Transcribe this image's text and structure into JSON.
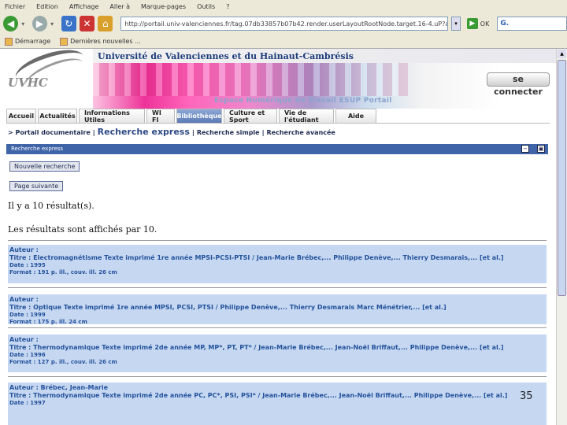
{
  "browser": {
    "menu": [
      "Fichier",
      "Edition",
      "Affichage",
      "Aller à",
      "Marque-pages",
      "Outils",
      "?"
    ],
    "address": "http://portail.univ-valenciennes.fr/tag.07db33857b07b42.render.userLayoutRootNode.target.16-4.uP?actio",
    "go_label": "OK",
    "search_value": "G.",
    "bookmarks": [
      "Démarrage",
      "Dernières nouvelles ..."
    ]
  },
  "header": {
    "university": "Université de Valenciennes et du Hainaut-Cambrésis",
    "logo_text": "UVHC",
    "espace": "Espace Numérique de Travail ESUP Portail",
    "connect_label": "se connecter"
  },
  "tabs": [
    {
      "label": "Accueil",
      "active": false
    },
    {
      "label": "Actualités",
      "active": false
    },
    {
      "label": "Informations Utiles",
      "active": false
    },
    {
      "label": "WI FI",
      "active": false
    },
    {
      "label": "Bibliothèque",
      "active": true
    },
    {
      "label": "Culture et Sport",
      "active": false
    },
    {
      "label": "Vie de l'étudiant",
      "active": false
    },
    {
      "label": "Aide",
      "active": false
    }
  ],
  "breadcrumb": {
    "arrow": ">",
    "items": [
      "Portail documentaire",
      "Recherche express",
      "Recherche simple",
      "Recherche avancée"
    ]
  },
  "portlet": {
    "title": "Recherche express",
    "min_icon": "−",
    "max_icon": "▣"
  },
  "buttons": {
    "new_search": "Nouvelle recherche",
    "next_page": "Page suivante"
  },
  "results_info": {
    "count_text": "Il y a 10 résultat(s).",
    "per_page_text": "Les résultats sont affichés par 10."
  },
  "results": [
    {
      "author": "Auteur :",
      "title": "Titre : Electromagnétisme Texte imprimé 1re année MPSI-PCSI-PTSI / Jean-Marie Brébec,... Philippe Denève,... Thierry Desmarais,... [et al.]",
      "date": "Date : 1995",
      "format": "Format : 191 p. ill., couv. ill. 26 cm"
    },
    {
      "author": "Auteur :",
      "title": "Titre : Optique Texte imprimé 1re année MPSI, PCSI, PTSI / Philippe Denève,... Thierry Desmarais Marc Ménétrier,... [et al.]",
      "date": "Date : 1999",
      "format": "Format : 175 p. ill. 24 cm"
    },
    {
      "author": "Auteur :",
      "title": "Titre : Thermodynamique Texte imprimé 2de année MP, MP*, PT, PT* / Jean-Marie Brébec,... Jean-Noël Briffaut,... Philippe Denève,... [et al.]",
      "date": "Date : 1996",
      "format": "Format : 127 p. ill., couv. ill. 26 cm"
    },
    {
      "author": "Auteur : Brébec, Jean-Marie",
      "title": "Titre : Thermodynamique Texte imprimé 2de année PC, PC*, PSI, PSI* / Jean-Marie Brébec,... Jean-Noël Briffaut,... Philippe Denève,... [et al.]",
      "date": "Date : 1997",
      "format": ""
    }
  ],
  "page_number": "35"
}
